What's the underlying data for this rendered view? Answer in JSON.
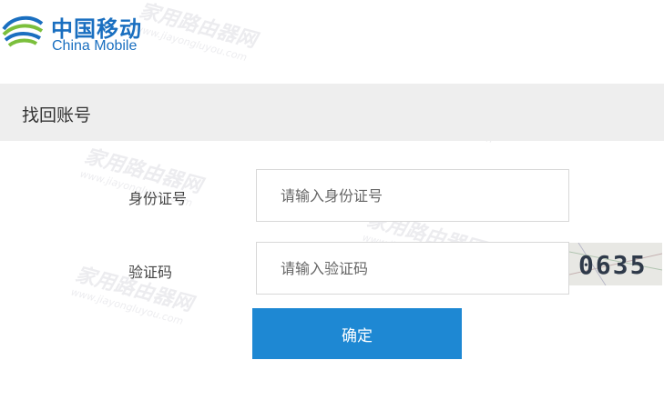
{
  "brand": {
    "name_cn": "中国移动",
    "name_en": "China Mobile",
    "color": "#1a6fc0"
  },
  "page": {
    "title": "找回账号"
  },
  "form": {
    "id_label": "身份证号",
    "id_placeholder": "请输入身份证号",
    "captcha_label": "验证码",
    "captcha_placeholder": "请输入验证码",
    "captcha_text": "0635",
    "submit_label": "确定",
    "accent_color": "#1e88d3"
  },
  "watermark": {
    "text_cn": "家用路由器网",
    "text_en": "www.jiayongluyou.com"
  }
}
